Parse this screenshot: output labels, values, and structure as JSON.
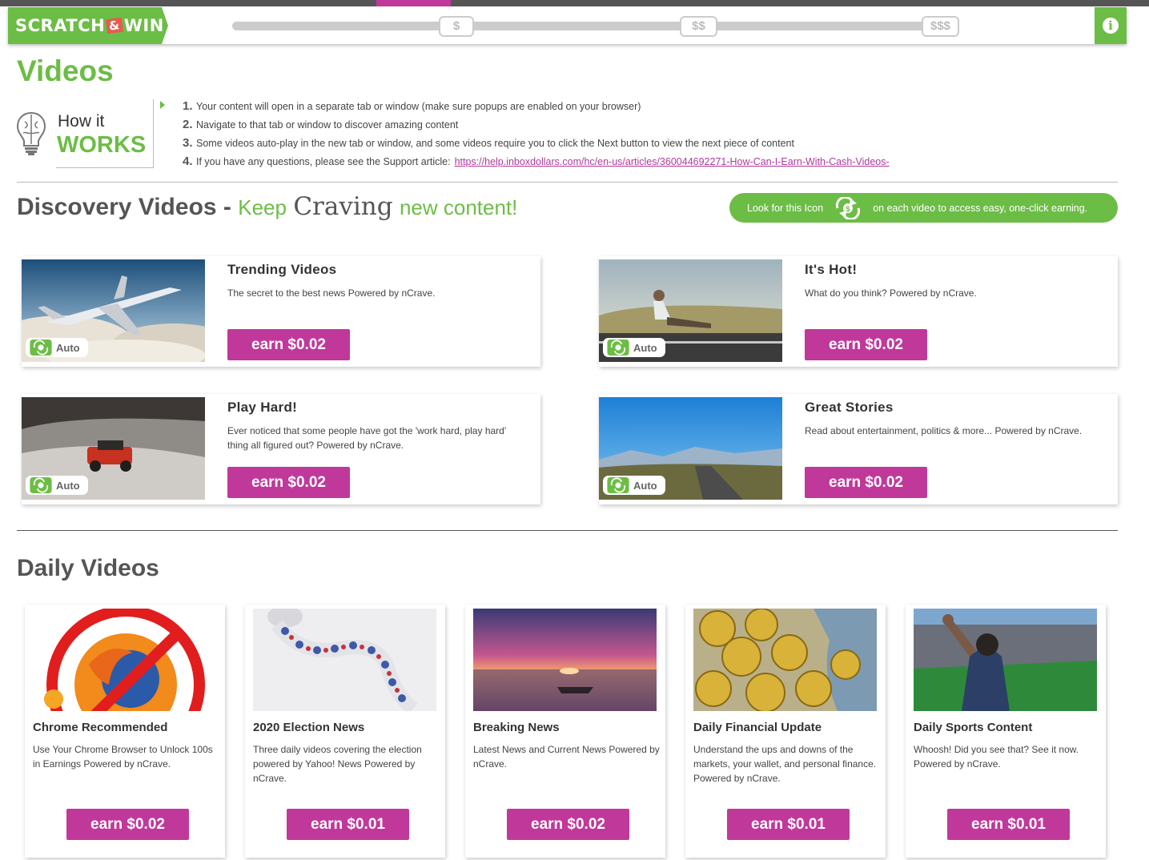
{
  "scratch": {
    "logo_text_1": "SCRATCH",
    "logo_text_amp": "&",
    "logo_text_2": "WIN",
    "tiers": [
      "$",
      "$$",
      "$$$"
    ],
    "info_label": "i"
  },
  "page": {
    "title": "Videos"
  },
  "how_it_works": {
    "line1": "How it",
    "line2": "WORKS",
    "steps": [
      {
        "num": "1.",
        "text": "Your content will open in a separate tab or window (make sure popups are enabled on your browser)"
      },
      {
        "num": "2.",
        "text": "Navigate to that tab or window to discover amazing content"
      },
      {
        "num": "3.",
        "text": "Some videos auto-play in the new tab or window, and some videos require you to click the Next button to view the next piece of content"
      },
      {
        "num": "4.",
        "text": "If you have any questions, please see the Support article:",
        "link": "https://help.inboxdollars.com/hc/en-us/articles/360044692271-How-Can-I-Earn-With-Cash-Videos-"
      }
    ]
  },
  "discovery": {
    "title_bold": "Discovery Videos -",
    "title_keep": "Keep",
    "title_craving": "Craving",
    "title_new": "new content!",
    "look_for": "Look for this Icon",
    "look_suffix": "on each video to access easy, one-click earning.",
    "auto_label": "Auto",
    "cards": [
      {
        "title": "Trending Videos",
        "desc": "The secret to the best news Powered by nCrave.",
        "earn": "earn $0.02"
      },
      {
        "title": "It's Hot!",
        "desc": "What do you think? Powered by nCrave.",
        "earn": "earn $0.02"
      },
      {
        "title": "Play Hard!",
        "desc": "Ever noticed that some people have got the 'work hard, play hard' thing all figured out? Powered by nCrave.",
        "earn": "earn $0.02"
      },
      {
        "title": "Great Stories",
        "desc": "Read about entertainment, politics & more... Powered by nCrave.",
        "earn": "earn $0.02"
      }
    ]
  },
  "daily": {
    "title": "Daily Videos",
    "cards": [
      {
        "title": "Chrome Recommended",
        "desc": "Use Your Chrome Browser to Unlock 100s in Earnings Powered by nCrave.",
        "earn": "earn $0.02"
      },
      {
        "title": "2020 Election News",
        "desc": "Three daily videos covering the election powered by Yahoo! News Powered by nCrave.",
        "earn": "earn $0.01"
      },
      {
        "title": "Breaking News",
        "desc": "Latest News and Current News Powered by nCrave.",
        "earn": "earn $0.02"
      },
      {
        "title": "Daily Financial Update",
        "desc": "Understand the ups and downs of the markets, your wallet, and personal finance. Powered by nCrave.",
        "earn": "earn $0.01"
      },
      {
        "title": "Daily Sports Content",
        "desc": "Whoosh! Did you see that? See it now. Powered by nCrave.",
        "earn": "earn $0.01"
      }
    ]
  },
  "colors": {
    "brand_green": "#6cbd45",
    "earn_magenta": "#c1389b",
    "link": "#b0399e"
  }
}
